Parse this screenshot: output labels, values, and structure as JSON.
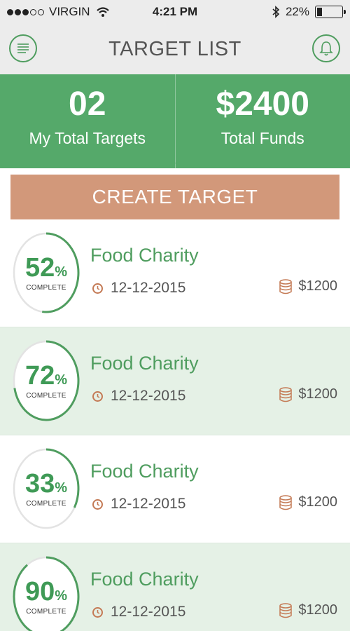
{
  "status_bar": {
    "carrier": "VIRGIN",
    "time": "4:21 PM",
    "battery": "22%",
    "battery_level": 0.22
  },
  "nav": {
    "title": "TARGET LIST",
    "menu_icon": "menu-icon",
    "notification_icon": "bell-icon"
  },
  "stats": {
    "total_targets": "02",
    "total_targets_label": "My Total Targets",
    "total_funds": "$2400",
    "total_funds_label": "Total Funds"
  },
  "create_button": "CREATE TARGET",
  "colors": {
    "green": "#55a96a",
    "ring": "#4f9d5f",
    "button": "#d2987a",
    "icon": "#c47a55"
  },
  "targets": [
    {
      "title": "Food Charity",
      "date": "12-12-2015",
      "amount": "$1200",
      "percent": 52,
      "percent_text": "52",
      "percent_sign": "%",
      "complete_label": "COMPLETE",
      "shaded": false
    },
    {
      "title": "Food Charity",
      "date": "12-12-2015",
      "amount": "$1200",
      "percent": 72,
      "percent_text": "72",
      "percent_sign": "%",
      "complete_label": "COMPLETE",
      "shaded": true
    },
    {
      "title": "Food Charity",
      "date": "12-12-2015",
      "amount": "$1200",
      "percent": 33,
      "percent_text": "33",
      "percent_sign": "%",
      "complete_label": "COMPLETE",
      "shaded": false
    },
    {
      "title": "Food Charity",
      "date": "12-12-2015",
      "amount": "$1200",
      "percent": 90,
      "percent_text": "90",
      "percent_sign": "%",
      "complete_label": "COMPLETE",
      "shaded": true
    }
  ]
}
